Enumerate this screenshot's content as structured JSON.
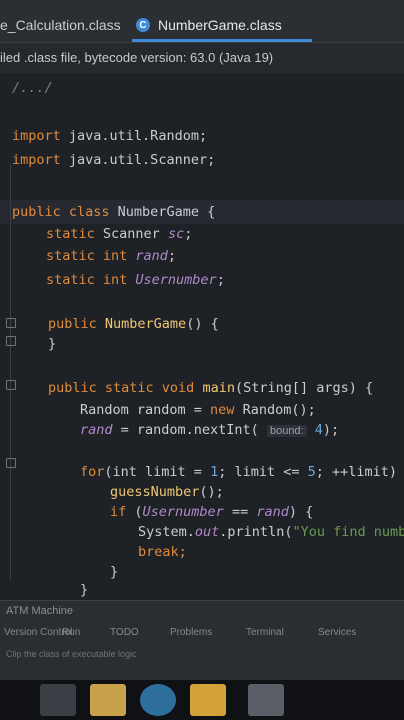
{
  "tabs": [
    {
      "label": "e_Calculation.class",
      "active": false
    },
    {
      "label": "NumberGame.class",
      "active": true,
      "icon": "java-class-icon"
    }
  ],
  "info_bar": "iled .class file, bytecode version: 63.0 (Java 19)",
  "code": {
    "comment": "/.../",
    "import1": [
      "import",
      " java.util.Random;"
    ],
    "import2": [
      "import",
      " java.util.Scanner;"
    ],
    "class_decl": [
      "public class",
      " NumberGame",
      " {"
    ],
    "field1": [
      "static",
      " Scanner",
      " sc",
      ";"
    ],
    "field2": [
      "static int",
      " rand",
      ";"
    ],
    "field3": [
      "static int",
      " Usernumber",
      ";"
    ],
    "ctor": [
      "public",
      " NumberGame",
      "() {"
    ],
    "ctor_close": "}",
    "main_decl": [
      "public static void",
      " main",
      "(String[] args) {"
    ],
    "random_line": [
      "Random random = ",
      "new",
      " Random();"
    ],
    "rand_line_pre": "rand",
    "rand_line_mid": " = random.nextInt( ",
    "rand_hint": "bound:",
    "rand_line_num": " 4",
    "rand_line_end": ");",
    "for_kw": "for",
    "for_mid": "(int limit = ",
    "for_num1": "1",
    "for_mid2": "; limit <= ",
    "for_num2": "5",
    "for_end": "; ++limit) {",
    "guess_call": "guessNumber",
    "guess_end": "();",
    "if_kw": "if",
    "if_mid": " (",
    "if_var1": "Usernumber",
    "if_mid2": " == ",
    "if_var2": "rand",
    "if_end": ") {",
    "println_pre": "System.",
    "println_out": "out",
    "println_mid": ".println(",
    "println_str": "\"You find number",
    "break_kw": "break;",
    "close1": "}",
    "close2": "}"
  },
  "bottom_panel": {
    "title": "ATM Machine",
    "tabs": [
      "Version Control",
      "Run",
      "TODO",
      "Problems",
      "Terminal",
      "Services"
    ],
    "status": "Clip the class of executable logic"
  },
  "colors": {
    "accent": "#3d8bd7",
    "keyword": "#e08b3c",
    "field": "#b189c9",
    "function": "#f0c674"
  }
}
